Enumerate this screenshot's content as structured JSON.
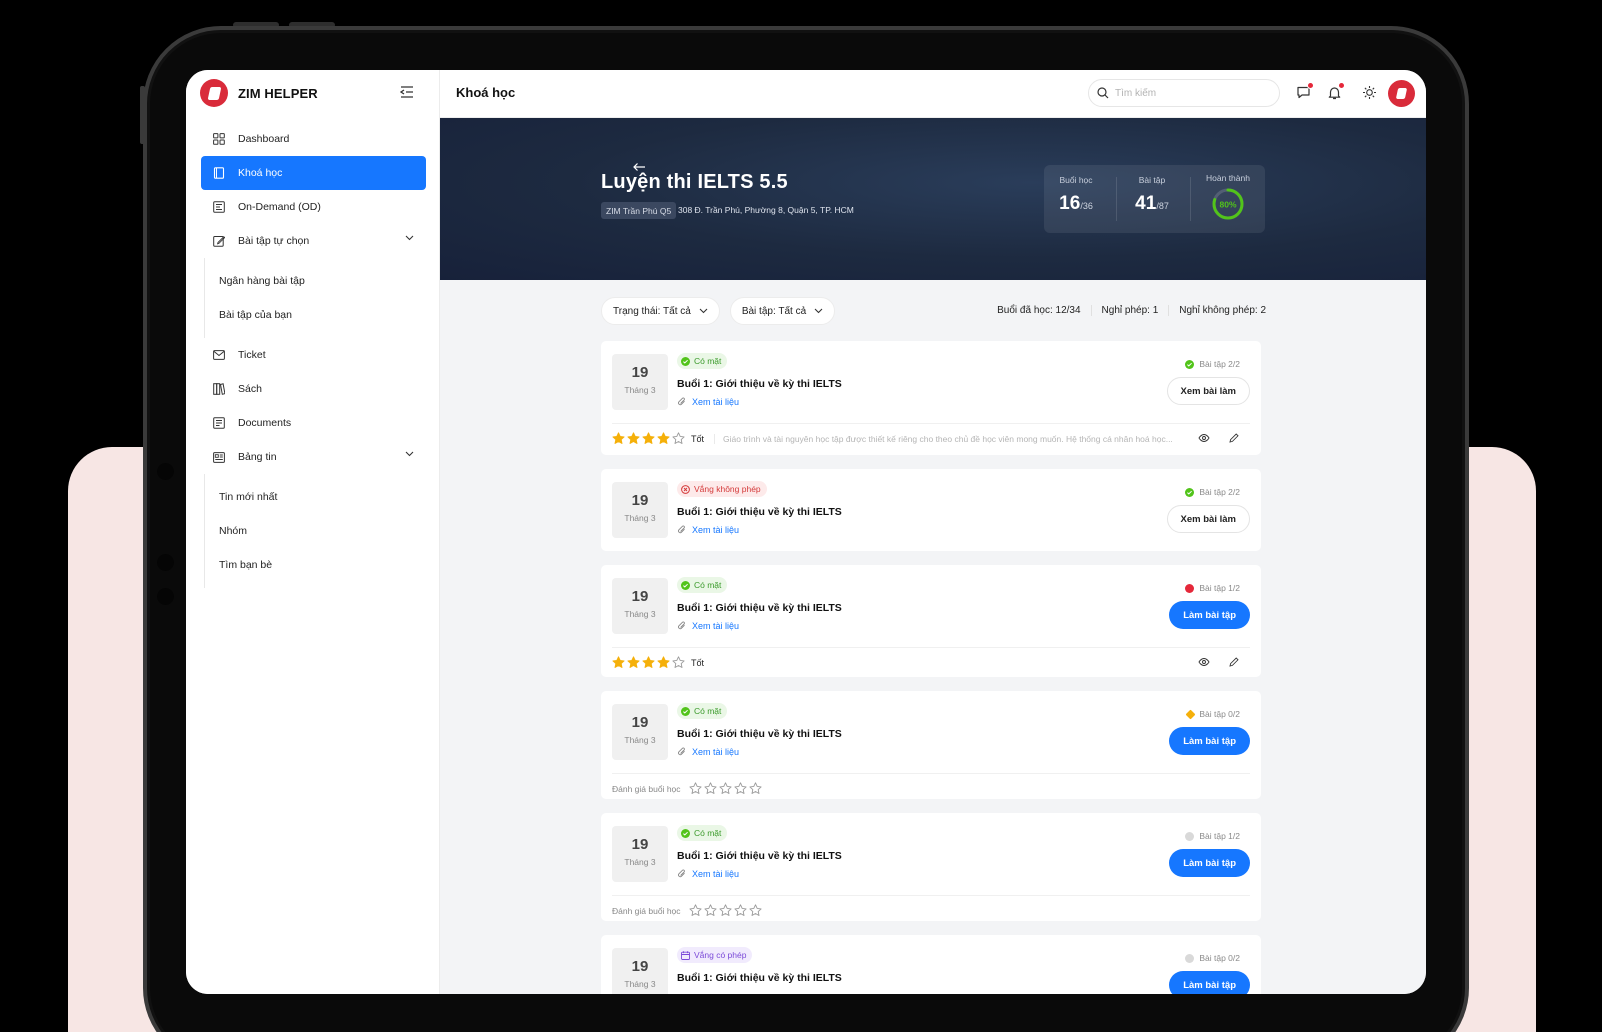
{
  "sidebar": {
    "brand": "ZIM HELPER",
    "items": [
      {
        "label": "Dashboard"
      },
      {
        "label": "Khoá học"
      },
      {
        "label": "On-Demand (OD)"
      },
      {
        "label": "Bài tập tự chọn"
      },
      {
        "label": "Ticket"
      },
      {
        "label": "Sách"
      },
      {
        "label": "Documents"
      },
      {
        "label": "Bảng tin"
      }
    ],
    "exercise_sub": [
      "Ngân hàng bài tập",
      "Bài tập của bạn"
    ],
    "news_sub": [
      "Tin mới nhất",
      "Nhóm",
      "Tìm bạn bè"
    ]
  },
  "topbar": {
    "title": "Khoá học",
    "search_placeholder": "Tìm kiếm"
  },
  "hero": {
    "title": "Luyện thi IELTS 5.5",
    "branch": "ZIM Trần Phú Q5",
    "address": "308 Đ. Trần Phú, Phường 8, Quận 5, TP. HCM",
    "stats": {
      "sessions_label": "Buổi học",
      "sessions_value": "16",
      "sessions_total": "/36",
      "homework_label": "Bài tập",
      "homework_value": "41",
      "homework_total": "/87",
      "complete_label": "Hoàn thành",
      "complete_text": "80%",
      "complete_fraction": 0.8
    }
  },
  "filters": {
    "status": "Trạng thái: Tất cả",
    "homework": "Bài tập: Tất cả"
  },
  "summary": {
    "attended": "Buổi đã học: 12/34",
    "excused": "Nghỉ phép: 1",
    "unexcused": "Nghỉ không phép: 2"
  },
  "colors": {
    "primary": "#1677ff",
    "brand": "#d92b3a",
    "hero_bg": "#1d2a40",
    "success": "#52c41a",
    "danger": "#e5283a",
    "warning": "#f5b00a"
  },
  "sessions": [
    {
      "day": "19",
      "month": "Tháng 3",
      "status": "Có mặt",
      "title": "Buổi 1: Giới thiệu về kỳ thi IELTS",
      "doc": "Xem tài liệu",
      "hw": "Bài tập 2/2",
      "action": "Xem bài làm",
      "rating_word": "Tốt",
      "stars": 4,
      "comment": "Giáo trình và tài nguyên học tập được thiết kế riêng cho theo chủ đề học viên mong muốn. Hệ thống cá nhân hoá học..."
    },
    {
      "day": "19",
      "month": "Tháng 3",
      "status": "Vắng không phép",
      "title": "Buổi 1: Giới thiệu về kỳ thi IELTS",
      "doc": "Xem tài liệu",
      "hw": "Bài tập 2/2",
      "action": "Xem bài làm"
    },
    {
      "day": "19",
      "month": "Tháng 3",
      "status": "Có mặt",
      "title": "Buổi 1: Giới thiệu về kỳ thi IELTS",
      "doc": "Xem tài liệu",
      "hw": "Bài tập 1/2",
      "action": "Làm bài tập",
      "rating_word": "Tốt",
      "stars": 4
    },
    {
      "day": "19",
      "month": "Tháng 3",
      "status": "Có mặt",
      "title": "Buổi 1: Giới thiệu về kỳ thi IELTS",
      "doc": "Xem tài liệu",
      "hw": "Bài tập 0/2",
      "action": "Làm bài tập",
      "rate_label": "Đánh giá buổi học"
    },
    {
      "day": "19",
      "month": "Tháng 3",
      "status": "Có mặt",
      "title": "Buổi 1: Giới thiệu về kỳ thi IELTS",
      "doc": "Xem tài liệu",
      "hw": "Bài tập 1/2",
      "action": "Làm bài tập",
      "rate_label": "Đánh giá buổi học"
    },
    {
      "day": "19",
      "month": "Tháng 3",
      "status": "Vắng có phép",
      "title": "Buổi 1: Giới thiệu về kỳ thi IELTS",
      "hw": "Bài tập 0/2",
      "action": "Làm bài tập"
    }
  ]
}
